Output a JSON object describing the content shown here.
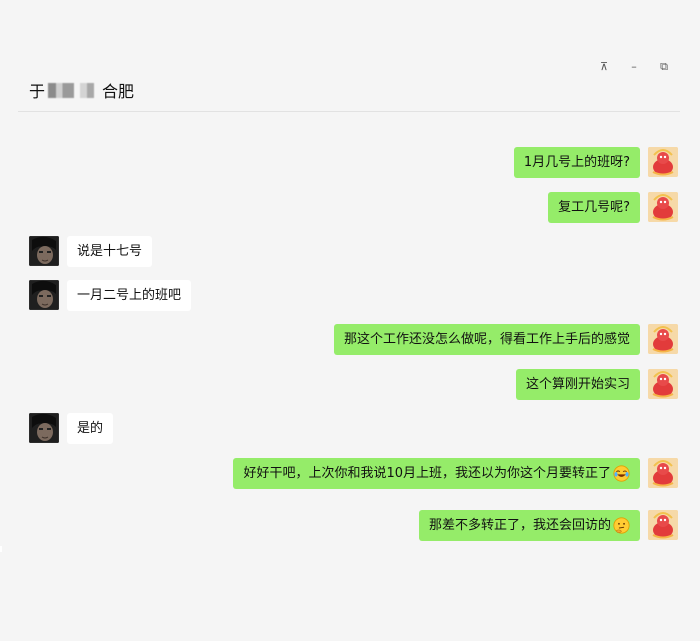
{
  "window": {
    "controls": {
      "pin": "⊼",
      "minimize": "–",
      "restore": "⧉"
    }
  },
  "chat": {
    "title_prefix": "于",
    "title_suffix": "合肥"
  },
  "messages": [
    {
      "side": "right",
      "text": "1月几号上的班呀?",
      "emoji": null
    },
    {
      "side": "right",
      "text": "复工几号呢?",
      "emoji": null
    },
    {
      "side": "left",
      "text": "说是十七号",
      "emoji": null
    },
    {
      "side": "left",
      "text": "一月二号上的班吧",
      "emoji": null
    },
    {
      "side": "right",
      "text": "那这个工作还没怎么做呢，得看工作上手后的感觉",
      "emoji": null
    },
    {
      "side": "right",
      "text": "这个算刚开始实习",
      "emoji": null
    },
    {
      "side": "left",
      "text": "是的",
      "emoji": null
    },
    {
      "side": "right",
      "text": "好好干吧，上次你和我说10月上班，我还以为你这个月要转正了",
      "emoji": "laugh-cry-emoji"
    },
    {
      "side": "right",
      "text": "那差不多转正了，我还会回访的",
      "emoji": "thinking-emoji"
    }
  ],
  "colors": {
    "my_bubble": "#95ec69",
    "their_bubble": "#ffffff",
    "background": "#f5f5f5"
  }
}
